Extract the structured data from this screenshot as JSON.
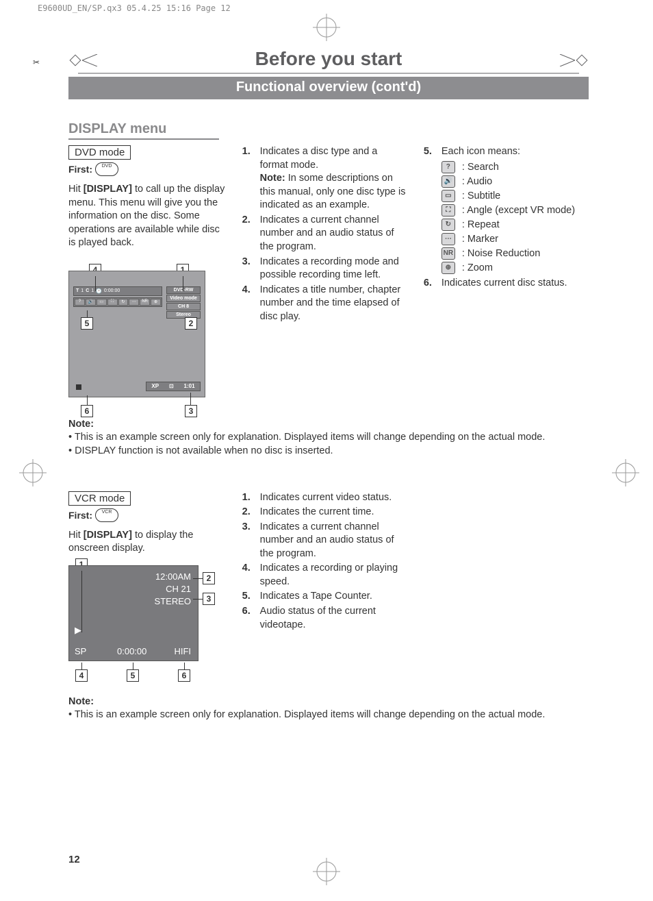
{
  "meta_header": "E9600UD_EN/SP.qx3  05.4.25 15:16  Page 12",
  "page_number": "12",
  "chapter_title": "Before you start",
  "chapter_subtitle": "Functional overview (cont'd)",
  "section_heading": "DISPLAY menu",
  "dvd": {
    "mode_box": "DVD mode",
    "first_label": "First:",
    "disc_label": "DVD",
    "intro_line1": "Hit ",
    "intro_bold": "[DISPLAY]",
    "intro_line2": " to call up the display menu. This menu will give you the information on the disc. Some operations are available while disc is played back.",
    "callouts": {
      "c1": "1",
      "c2": "2",
      "c3": "3",
      "c4": "4",
      "c5": "5",
      "c6": "6"
    },
    "osd": {
      "t": "T",
      "t_val": "1",
      "c": "C",
      "c_val": "1",
      "clock": "0:00:00",
      "disc_type": "DVD-RW",
      "video_mode": "Video mode",
      "ch": "CH 8",
      "audio": "Stereo",
      "xp": "XP",
      "rec_time": "1:01",
      "mini": "NR"
    },
    "list": [
      {
        "num": "1.",
        "txt_pre": "Indicates a disc type and a format mode.\n",
        "note_label": "Note:",
        "note_txt": " In some descriptions on this manual, only one disc type is indicated as an example."
      },
      {
        "num": "2.",
        "txt": "Indicates a current channel number and an audio status of the program."
      },
      {
        "num": "3.",
        "txt": "Indicates a recording mode and possible recording time left."
      },
      {
        "num": "4.",
        "txt": "Indicates a title number, chapter number and the time elapsed of disc play."
      }
    ],
    "icons_lead": {
      "num": "5.",
      "txt": "Each icon means:"
    },
    "icons": [
      {
        "g": "?",
        "label": ": Search"
      },
      {
        "g": "🔊",
        "label": ": Audio"
      },
      {
        "g": "▭",
        "label": ": Subtitle"
      },
      {
        "g": "⛶",
        "label": ": Angle (except VR mode)"
      },
      {
        "g": "↻",
        "label": ": Repeat"
      },
      {
        "g": "⋯",
        "label": ": Marker"
      },
      {
        "g": "NR",
        "label": ": Noise Reduction"
      },
      {
        "g": "⊕",
        "label": ": Zoom"
      }
    ],
    "item6": {
      "num": "6.",
      "txt": "Indicates current disc status."
    }
  },
  "note1": {
    "label": "Note:",
    "b1": "• This is an example screen only for explanation. Displayed items will change depending on the actual mode.",
    "b2": "• DISPLAY function is not available when no disc is inserted."
  },
  "vcr": {
    "mode_box": "VCR mode",
    "first_label": "First:",
    "disc_label": "VCR",
    "intro_line1": "Hit ",
    "intro_bold": "[DISPLAY]",
    "intro_line2": " to display the onscreen display.",
    "callouts": {
      "c1": "1",
      "c2": "2",
      "c3": "3",
      "c4": "4",
      "c5": "5",
      "c6": "6"
    },
    "osd": {
      "time": "12:00AM",
      "ch": "CH 21",
      "stereo": "STEREO",
      "play": "▶",
      "sp": "SP",
      "counter": "0:00:00",
      "hifi": "HIFI"
    },
    "list": [
      {
        "num": "1.",
        "txt": "Indicates current video status."
      },
      {
        "num": "2.",
        "txt": "Indicates the current time."
      },
      {
        "num": "3.",
        "txt": "Indicates a current channel number and an audio status of the program."
      },
      {
        "num": "4.",
        "txt": "Indicates a recording or playing speed."
      },
      {
        "num": "5.",
        "txt": "Indicates a Tape Counter."
      },
      {
        "num": "6.",
        "txt": "Audio status of the current videotape."
      }
    ]
  },
  "note2": {
    "label": "Note:",
    "b1": "• This is an example screen only for explanation. Displayed items will change depending on the actual mode."
  }
}
